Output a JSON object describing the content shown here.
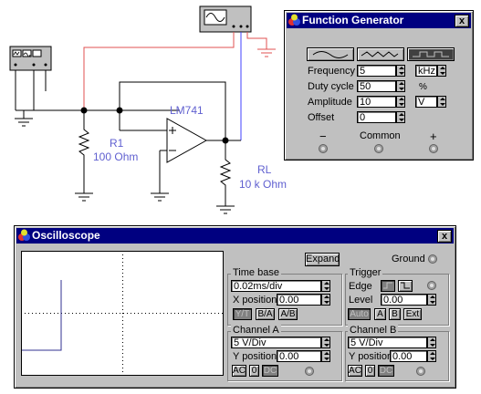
{
  "schematic": {
    "r1_name": "R1",
    "r1_value": "100  Ohm",
    "rl_name": "RL",
    "rl_value": "10 k Ohm",
    "opamp_name": "LM741",
    "wire_red": "#e05050",
    "wire_blue": "#4040ff",
    "label_blue": "#6060d0"
  },
  "function_generator": {
    "title": "Function Generator",
    "close_label": "x",
    "waveforms": [
      "sine-wave-icon",
      "triangle-wave-icon",
      "square-wave-icon"
    ],
    "selected_waveform": "square-wave-icon",
    "frequency": {
      "label": "Frequency",
      "value": "5",
      "unit": "kHz"
    },
    "duty_cycle": {
      "label": "Duty cycle",
      "value": "50",
      "unit": "%"
    },
    "amplitude": {
      "label": "Amplitude",
      "value": "10",
      "unit": "V"
    },
    "offset": {
      "label": "Offset",
      "value": "0"
    },
    "terminals": {
      "minus": "−",
      "common": "Common",
      "plus": "+"
    }
  },
  "oscilloscope": {
    "title": "Oscilloscope",
    "close_label": "x",
    "expand_label": "Expand",
    "ground_label": "Ground",
    "time_base": {
      "title": "Time base",
      "value": "0.02ms/div",
      "x_position_label": "X position",
      "x_position_value": "0.00",
      "buttons": [
        "Y/T",
        "B/A",
        "A/B"
      ]
    },
    "trigger": {
      "title": "Trigger",
      "edge_label": "Edge",
      "level_label": "Level",
      "level_value": "0.00",
      "buttons": [
        "Auto",
        "A",
        "B",
        "Ext"
      ]
    },
    "channel_a": {
      "title": "Channel A",
      "value": "5  V/Div",
      "y_position_label": "Y position",
      "y_position_value": "0.00",
      "buttons": [
        "AC",
        "0",
        "DC"
      ]
    },
    "channel_b": {
      "title": "Channel B",
      "value": "5  V/Div",
      "y_position_label": "Y position",
      "y_position_value": "0.00",
      "buttons": [
        "AC",
        "0",
        "DC"
      ]
    },
    "trace_color": "#303090"
  }
}
